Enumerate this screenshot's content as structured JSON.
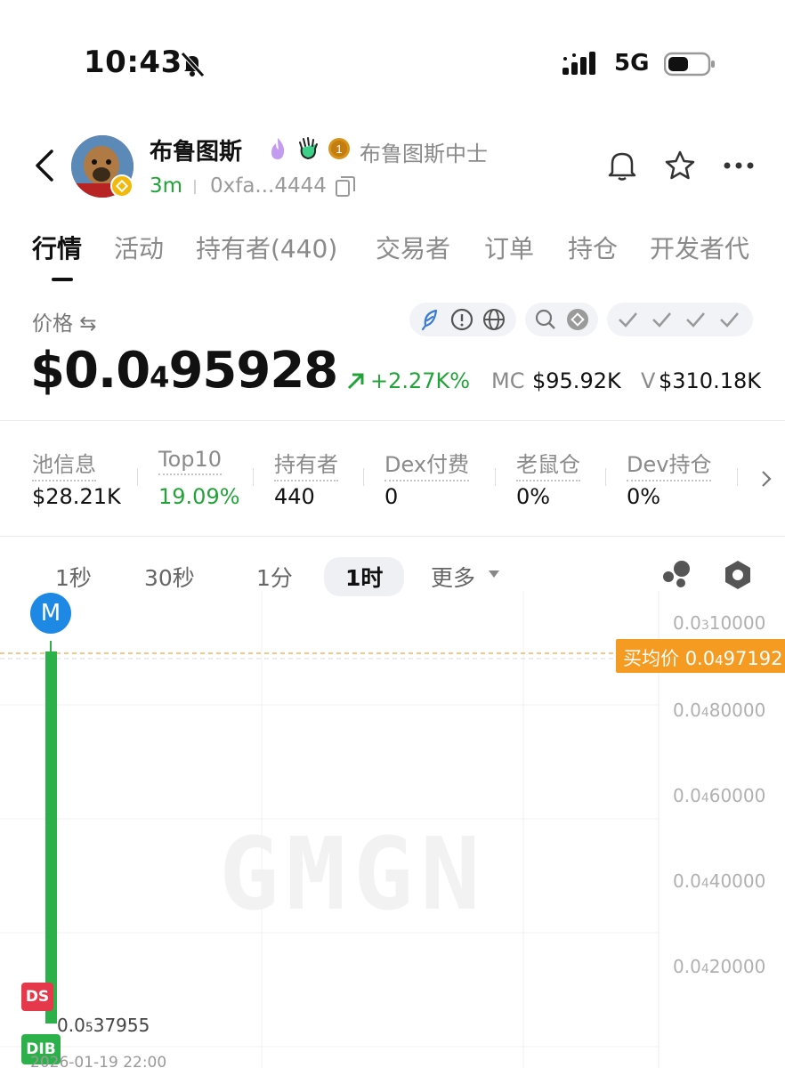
{
  "status": {
    "time": "10:43",
    "network": "5G"
  },
  "token": {
    "name": "布鲁图斯",
    "subtitle": "布鲁图斯中士",
    "coin_rank": "1",
    "age": "3m",
    "address": "0xfa...4444"
  },
  "tabs": [
    "行情",
    "活动",
    "持有者(440)",
    "交易者",
    "订单",
    "持仓",
    "开发者代"
  ],
  "price": {
    "label": "价格 ⇆",
    "value_main": "$0.0",
    "value_sub": "4",
    "value_rest": "95928",
    "change": "+2.27K%",
    "mc_label": "MC",
    "mc_value": "$95.92K",
    "vol_label": "V",
    "vol_value": "$310.18K"
  },
  "metrics": [
    {
      "label": "池信息",
      "value": "$28.21K"
    },
    {
      "label": "Top10",
      "value": "19.09%"
    },
    {
      "label": "持有者",
      "value": "440"
    },
    {
      "label": "Dex付费",
      "value": "0"
    },
    {
      "label": "老鼠仓",
      "value": "0%"
    },
    {
      "label": "Dev持仓",
      "value": "0%"
    }
  ],
  "intervals": [
    "1秒",
    "30秒",
    "1分",
    "1时",
    "更多"
  ],
  "active_interval": "1时",
  "chart": {
    "yticks": [
      {
        "pre": "0.0",
        "sub": "3",
        "post": "10000"
      },
      {
        "pre": "0.0",
        "sub": "4",
        "post": "80000"
      },
      {
        "pre": "0.0",
        "sub": "4",
        "post": "60000"
      },
      {
        "pre": "0.0",
        "sub": "4",
        "post": "40000"
      },
      {
        "pre": "0.0",
        "sub": "4",
        "post": "20000"
      }
    ],
    "avg_label": "买均价",
    "avg_value_pre": "0.0",
    "avg_value_sub": "4",
    "avg_value_post": "97192",
    "low_pre": "0.0",
    "low_sub": "5",
    "low_post": "37955",
    "marker_m": "M",
    "marker_ds": "DS",
    "marker_dib": "DIB",
    "date": "2026-01-19 22:00",
    "watermark": "GMGN"
  },
  "colors": {
    "up": "#22a33a",
    "accent": "#f59b22",
    "marker": "#1e88e5",
    "down": "#e5384b"
  }
}
